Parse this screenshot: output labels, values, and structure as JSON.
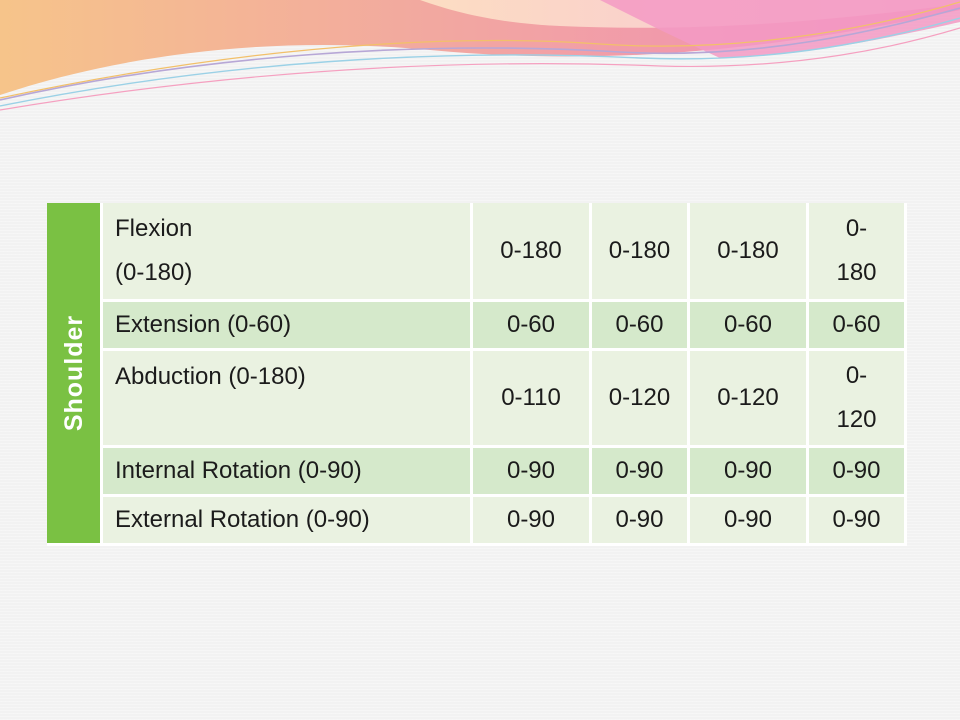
{
  "table": {
    "group_label": "Shoulder",
    "rows": [
      {
        "measure_line1": "Flexion",
        "measure_line2": "(0-180)",
        "values": [
          "0-180",
          "0-180",
          "0-180"
        ],
        "last_line1": "0-",
        "last_line2": "180"
      },
      {
        "measure": "Extension (0-60)",
        "values": [
          "0-60",
          "0-60",
          "0-60",
          "0-60"
        ]
      },
      {
        "measure": "Abduction (0-180)",
        "values": [
          "0-110",
          "0-120",
          "0-120"
        ],
        "last_line1": "0-",
        "last_line2": "120"
      },
      {
        "measure": "Internal Rotation (0-90)",
        "values": [
          "0-90",
          "0-90",
          "0-90",
          "0-90"
        ]
      },
      {
        "measure": "External Rotation (0-90)",
        "values": [
          "0-90",
          "0-90",
          "0-90",
          "0-90"
        ]
      }
    ]
  },
  "colors": {
    "group_bg": "#7ac143",
    "row_light": "#eaf2e1",
    "row_dark": "#d5e9cb",
    "header_wave_pink": "#f08fb5",
    "header_wave_orange": "#f6b27a"
  }
}
